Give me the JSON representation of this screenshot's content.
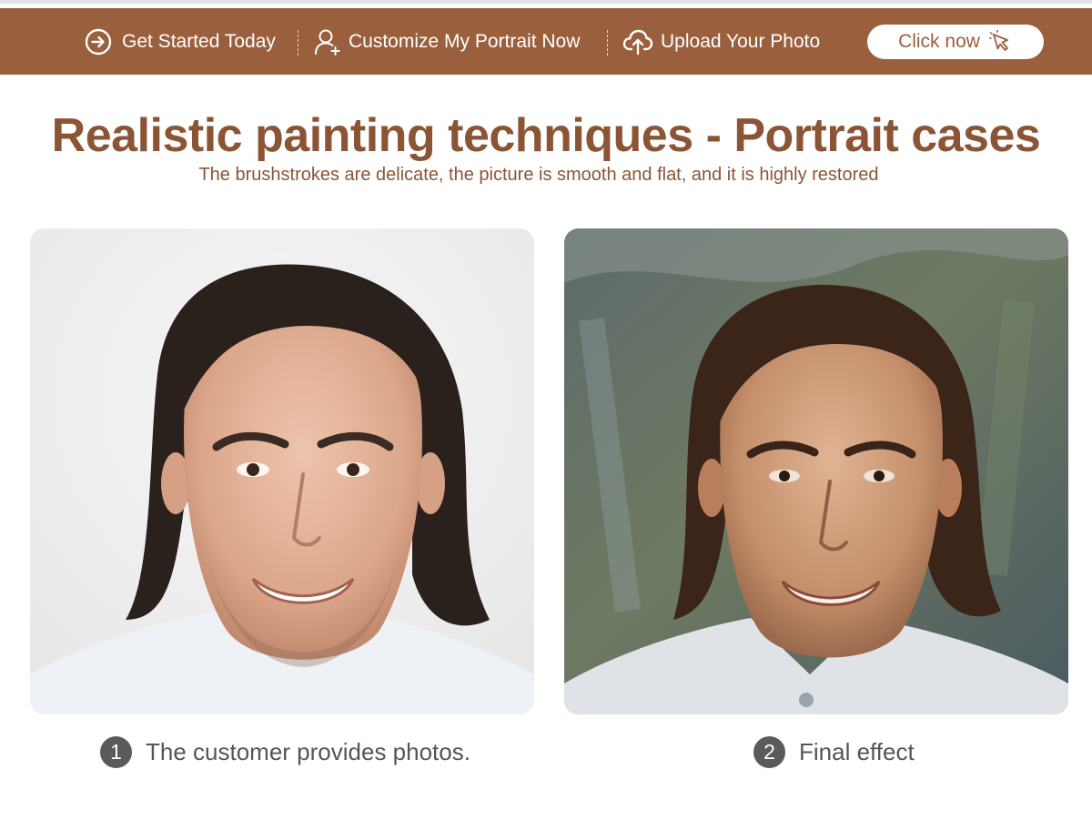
{
  "nav": {
    "items": [
      {
        "label": "Get Started Today",
        "icon": "arrow-right-circle-icon"
      },
      {
        "label": "Customize My Portrait Now",
        "icon": "user-add-icon"
      },
      {
        "label": "Upload Your Photo",
        "icon": "cloud-upload-icon"
      }
    ],
    "cta": {
      "label": "Click now",
      "icon": "pointer-click-icon"
    }
  },
  "hero": {
    "title": "Realistic painting techniques - Portrait cases",
    "subtitle": "The brushstrokes are delicate, the picture is smooth and flat, and it is highly restored"
  },
  "cases": [
    {
      "number": "1",
      "caption": "The customer provides photos.",
      "image": "customer-photo"
    },
    {
      "number": "2",
      "caption": "Final effect",
      "image": "oil-painting-portrait"
    }
  ],
  "colors": {
    "brand": "#9a5f3d",
    "title": "#8b5535",
    "caption_text": "#555555",
    "badge": "#5a5a5a"
  }
}
